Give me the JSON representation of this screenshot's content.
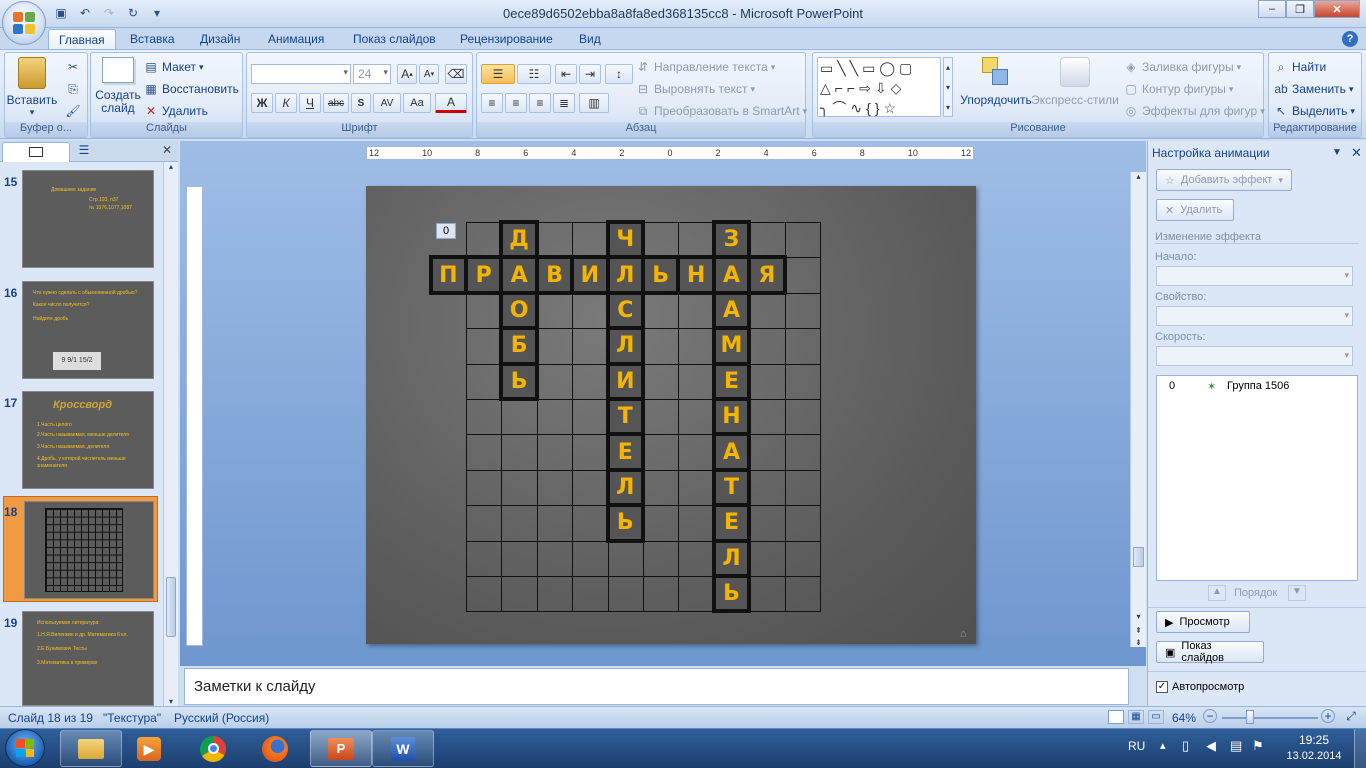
{
  "window": {
    "title": "0ece89d6502ebba8a8fa8ed368135cc8 - Microsoft PowerPoint"
  },
  "tabs": [
    "Главная",
    "Вставка",
    "Дизайн",
    "Анимация",
    "Показ слайдов",
    "Рецензирование",
    "Вид"
  ],
  "active_tab": "Главная",
  "ribbon": {
    "clipboard": {
      "paste": "Вставить",
      "label": "Буфер о..."
    },
    "slides": {
      "new_slide": "Создать слайд",
      "layout": "Макет",
      "reset": "Восстановить",
      "delete": "Удалить",
      "label": "Слайды"
    },
    "font": {
      "font_name": "",
      "font_size": "24",
      "label": "Шрифт",
      "bold": "Ж",
      "italic": "К",
      "underline": "Ч",
      "strike": "abc",
      "spacing": "AV",
      "case": "Aa",
      "color": "A"
    },
    "paragraph": {
      "text_direction": "Направление текста",
      "align_text": "Выровнять текст",
      "smartart": "Преобразовать в SmartArt",
      "label": "Абзац"
    },
    "drawing": {
      "arrange": "Упорядочить",
      "quick_styles": "Экспресс-стили",
      "fill": "Заливка фигуры",
      "outline": "Контур фигуры",
      "effects": "Эффекты для фигур",
      "label": "Рисование"
    },
    "editing": {
      "find": "Найти",
      "replace": "Заменить",
      "select": "Выделить",
      "label": "Редактирование"
    }
  },
  "slides_pane": {
    "thumbs": [
      {
        "num": "15",
        "lines": [
          "Домашнее задание",
          "Стр.193, п37",
          "№ 1076,1077,1087"
        ]
      },
      {
        "num": "16",
        "lines": [
          "Что нужно сделать с обыкновенной дробью?",
          "Какое число получится?",
          "Найдите дробь"
        ],
        "fraction": "9 9/1 15/2"
      },
      {
        "num": "17",
        "title": "Кроссворд",
        "lines": [
          "1.Часть целого",
          "2.Часть называемая, меньше делителя",
          "3.Часть называемая, делителя",
          "4.Дробь, у которой числитель меньше знаменателя"
        ]
      },
      {
        "num": "18"
      },
      {
        "num": "19",
        "lines": [
          "Используемая литература:",
          "1.Н.Я.Виленкин и др. Математика 6 кл.",
          "2.Е.Бунимович Тесты",
          "3.Математика в примерах"
        ]
      }
    ]
  },
  "slide": {
    "anim_tag": "0",
    "crossword": {
      "across": "ПРАВИЛЬНАЯ",
      "down1": "ДРОБЬ",
      "down2": "ЧИСЛИТЕЛЬ",
      "down3": "ЗНАМЕНАТЕЛЬ"
    }
  },
  "notes": {
    "placeholder": "Заметки к слайду"
  },
  "anim_pane": {
    "title": "Настройка анимации",
    "add_effect": "Добавить эффект",
    "remove": "Удалить",
    "change_effect": "Изменение эффекта",
    "start_label": "Начало:",
    "property_label": "Свойство:",
    "speed_label": "Скорость:",
    "list_item_num": "0",
    "list_item": "Группа 1506",
    "order_label": "Порядок",
    "preview": "Просмотр",
    "slideshow": "Показ слайдов",
    "autopreview": "Автопросмотр"
  },
  "status": {
    "slide": "Слайд 18 из 19",
    "theme": "\"Текстура\"",
    "language": "Русский (Россия)",
    "zoom": "64%"
  },
  "taskbar": {
    "lang": "RU",
    "time": "19:25",
    "date": "13.02.2014"
  },
  "ruler": {
    "h": [
      "12",
      "10",
      "8",
      "6",
      "4",
      "2",
      "0",
      "2",
      "4",
      "6",
      "8",
      "10",
      "12"
    ]
  }
}
